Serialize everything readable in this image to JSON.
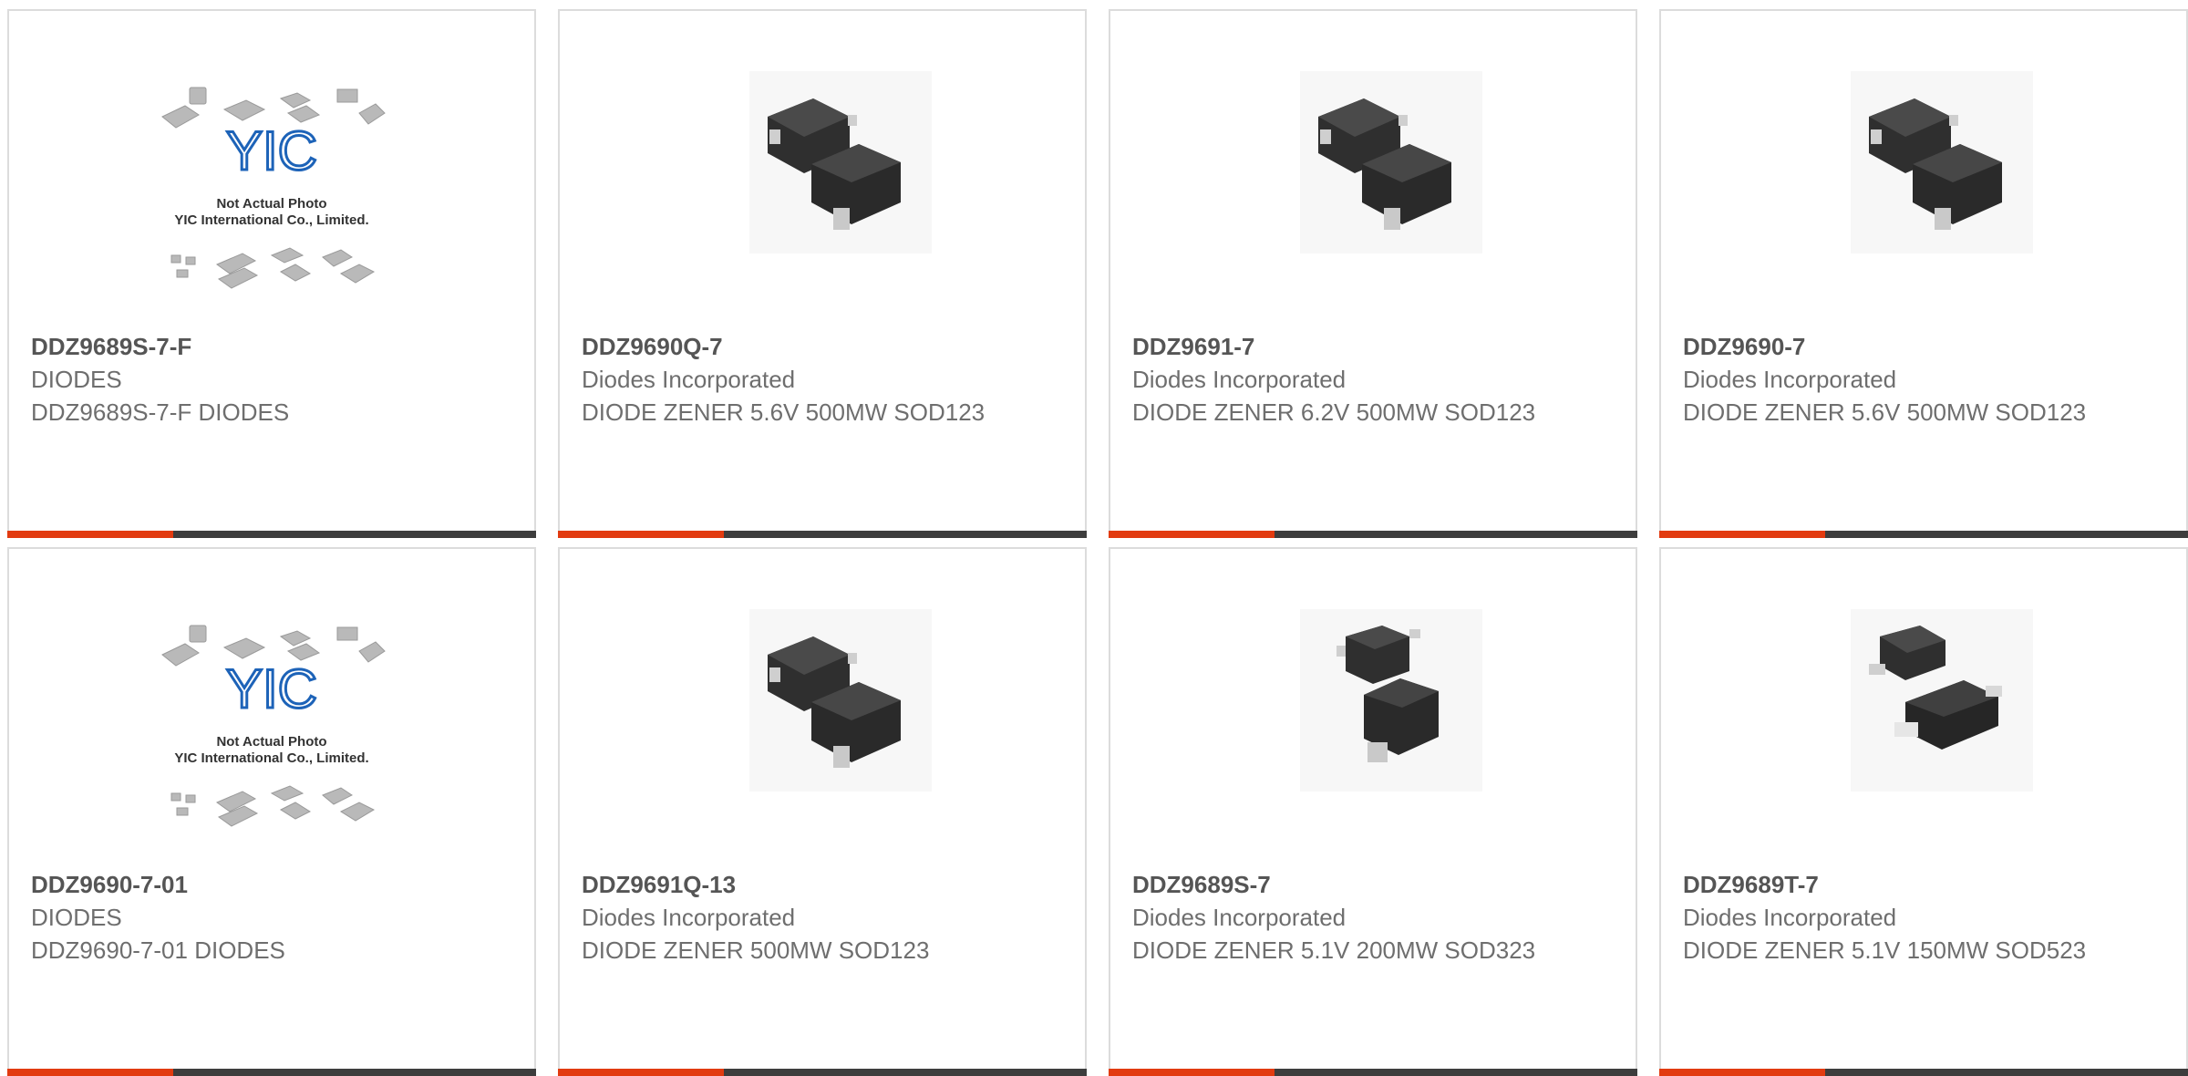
{
  "colors": {
    "accent": "#e23b10",
    "bar": "#3d3d3d",
    "border": "#dcdcdc"
  },
  "placeholder": {
    "line1": "Not Actual Photo",
    "line2": "YIC International Co., Limited."
  },
  "products": [
    {
      "part": "DDZ9689S-7-F",
      "manufacturer": "DIODES",
      "description": "DDZ9689S-7-F DIODES",
      "image": "placeholder"
    },
    {
      "part": "DDZ9690Q-7",
      "manufacturer": "Diodes Incorporated",
      "description": "DIODE ZENER 5.6V 500MW SOD123",
      "image": "sod123"
    },
    {
      "part": "DDZ9691-7",
      "manufacturer": "Diodes Incorporated",
      "description": "DIODE ZENER 6.2V 500MW SOD123",
      "image": "sod123"
    },
    {
      "part": "DDZ9690-7",
      "manufacturer": "Diodes Incorporated",
      "description": "DIODE ZENER 5.6V 500MW SOD123",
      "image": "sod123"
    },
    {
      "part": "DDZ9690-7-01",
      "manufacturer": "DIODES",
      "description": "DDZ9690-7-01 DIODES",
      "image": "placeholder"
    },
    {
      "part": "DDZ9691Q-13",
      "manufacturer": "Diodes Incorporated",
      "description": "DIODE ZENER 500MW SOD123",
      "image": "sod123"
    },
    {
      "part": "DDZ9689S-7",
      "manufacturer": "Diodes Incorporated",
      "description": "DIODE ZENER 5.1V 200MW SOD323",
      "image": "sod323"
    },
    {
      "part": "DDZ9689T-7",
      "manufacturer": "Diodes Incorporated",
      "description": "DIODE ZENER 5.1V 150MW SOD523",
      "image": "sod523"
    }
  ]
}
